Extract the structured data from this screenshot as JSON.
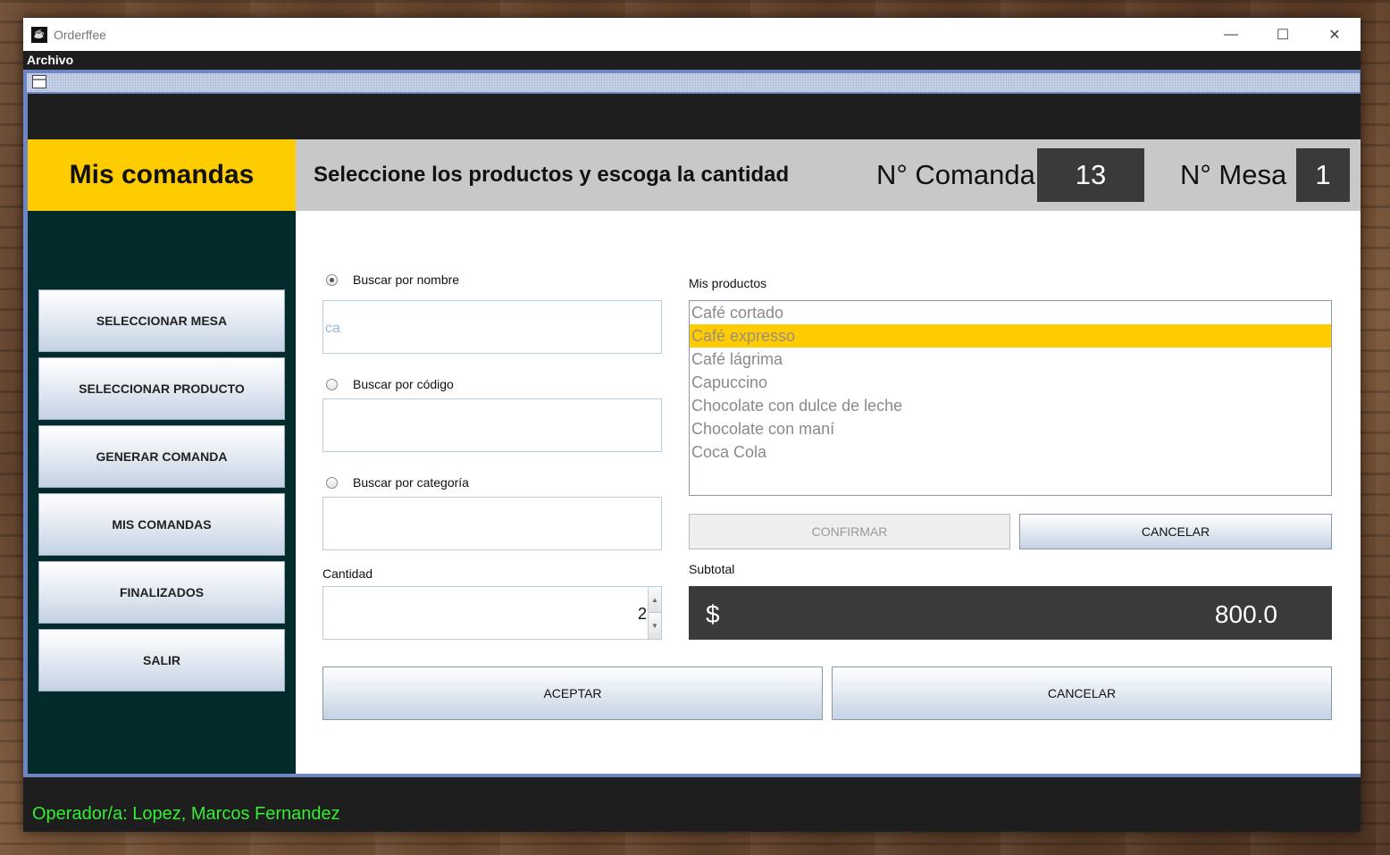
{
  "window": {
    "title": "Orderffee",
    "app_icon": "coffee-bean-icon",
    "controls": {
      "minimize": "—",
      "maximize": "☐",
      "close": "✕"
    }
  },
  "menu": {
    "archivo": "Archivo"
  },
  "header": {
    "section_title": "Mis comandas",
    "instruction": "Seleccione los productos y escoga la cantidad",
    "comanda_label": "N° Comanda",
    "comanda_value": "13",
    "mesa_label": "N° Mesa",
    "mesa_value": "1"
  },
  "sidebar": {
    "items": [
      {
        "label": "SELECCIONAR MESA"
      },
      {
        "label": "SELECCIONAR PRODUCTO"
      },
      {
        "label": "GENERAR COMANDA"
      },
      {
        "label": "MIS COMANDAS"
      },
      {
        "label": "FINALIZADOS"
      },
      {
        "label": "SALIR"
      }
    ]
  },
  "search": {
    "by_name_label": "Buscar por nombre",
    "by_name_value": "ca",
    "by_name_checked": true,
    "by_code_label": "Buscar por código",
    "by_code_value": "",
    "by_category_label": "Buscar por categoría",
    "by_category_value": ""
  },
  "quantity": {
    "label": "Cantidad",
    "value": "2"
  },
  "products": {
    "label": "Mis productos",
    "items": [
      "Café cortado",
      "Café expresso",
      "Café lágrima",
      "Capuccino",
      "Chocolate con dulce de leche",
      "Chocolate con maní",
      "Coca Cola"
    ],
    "selected_index": 1
  },
  "product_actions": {
    "confirm": "CONFIRMAR",
    "cancel": "CANCELAR"
  },
  "subtotal": {
    "label": "Subtotal",
    "currency": "$",
    "value": "800.0"
  },
  "actions": {
    "accept": "ACEPTAR",
    "cancel": "CANCELAR"
  },
  "status": {
    "operator": "Operador/a: Lopez, Marcos Fernandez"
  },
  "colors": {
    "accent": "#ffcc00",
    "sidebar": "#032b2b",
    "frame_border": "#6f86c4",
    "status_text": "#33ee33"
  }
}
